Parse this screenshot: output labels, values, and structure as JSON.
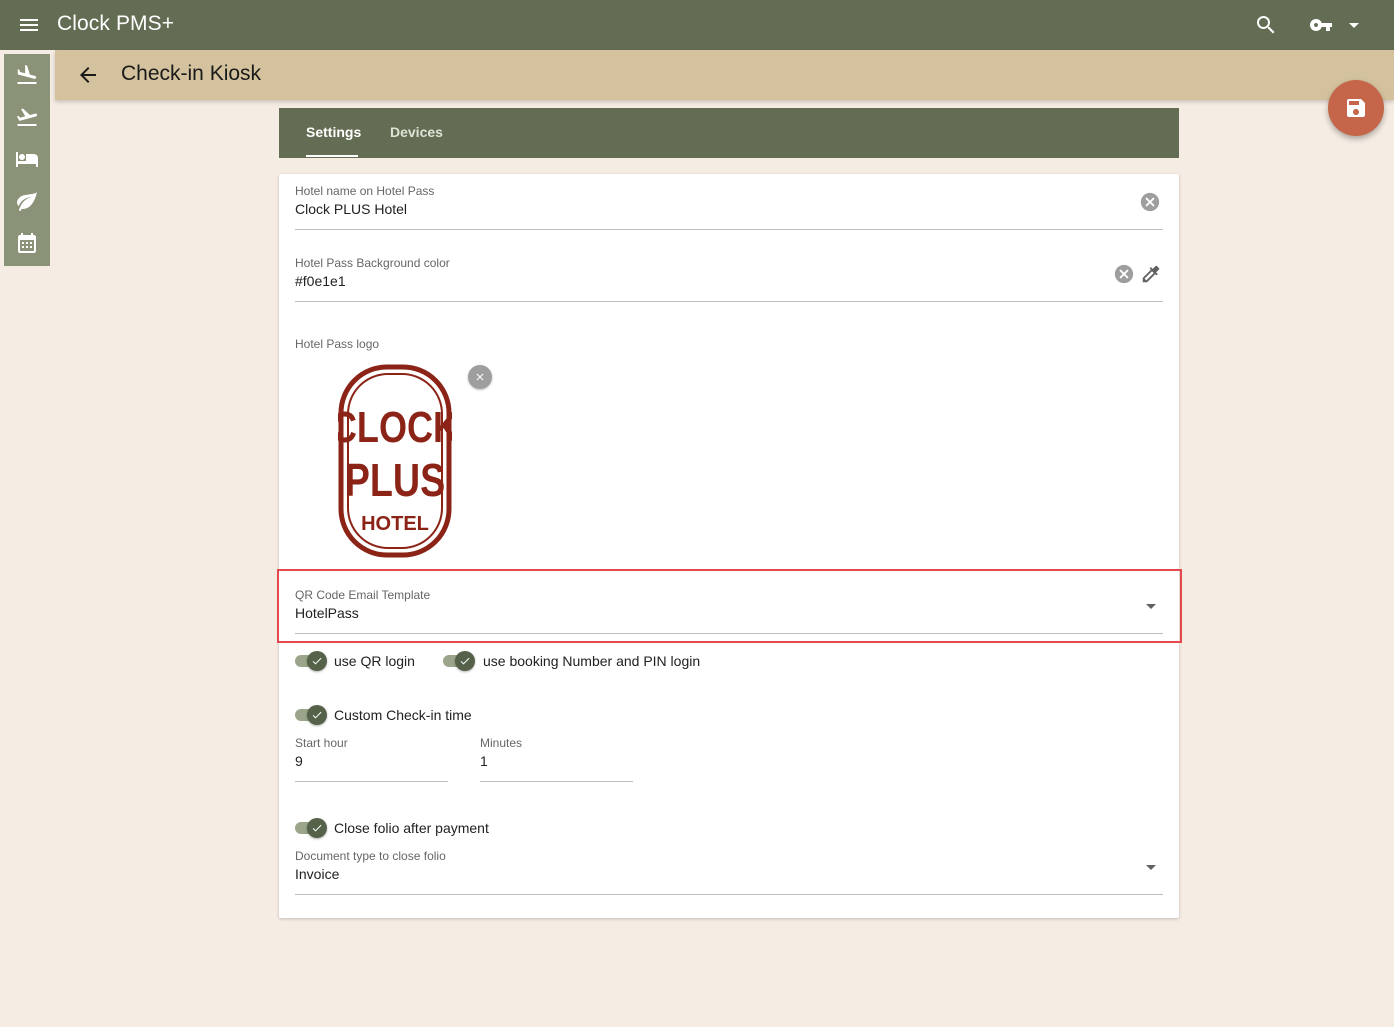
{
  "app": {
    "title": "Clock PMS+"
  },
  "icons": {
    "menu": "menu-icon",
    "search": "search-icon",
    "account": "key-icon",
    "rail": [
      "flight-land-icon",
      "flight-takeoff-icon",
      "hotel-bed-icon",
      "leaf-icon",
      "calendar-icon"
    ],
    "back": "arrow-back-icon",
    "save": "save-icon"
  },
  "page": {
    "title": "Check-in Kiosk"
  },
  "tabs": [
    {
      "label": "Settings",
      "active": true
    },
    {
      "label": "Devices",
      "active": false
    }
  ],
  "form": {
    "hotel_name": {
      "label": "Hotel name on Hotel Pass",
      "value": "Clock PLUS Hotel"
    },
    "bg_color": {
      "label": "Hotel Pass Background color",
      "value": "#f0e1e1"
    },
    "logo": {
      "label": "Hotel Pass logo",
      "text_line1": "CLOCK",
      "text_line2": "PLUS",
      "text_line3": "HOTEL"
    },
    "qr_template": {
      "label": "QR Code Email Template",
      "value": "HotelPass"
    },
    "toggles": {
      "qr_login": "use QR login",
      "booking_pin_login": "use booking Number and PIN login",
      "custom_checkin": "Custom Check-in time",
      "close_folio": "Close folio after payment"
    },
    "start_hour": {
      "label": "Start hour",
      "value": "9"
    },
    "minutes": {
      "label": "Minutes",
      "value": "1"
    },
    "doc_type": {
      "label": "Document type to close folio",
      "value": "Invoice"
    }
  },
  "colors": {
    "topbar": "#636d53",
    "subheader": "#d3c29d",
    "background": "#f5ece3",
    "fab": "#c5664a",
    "highlight": "#e5484d",
    "logo": "#8b2417"
  }
}
